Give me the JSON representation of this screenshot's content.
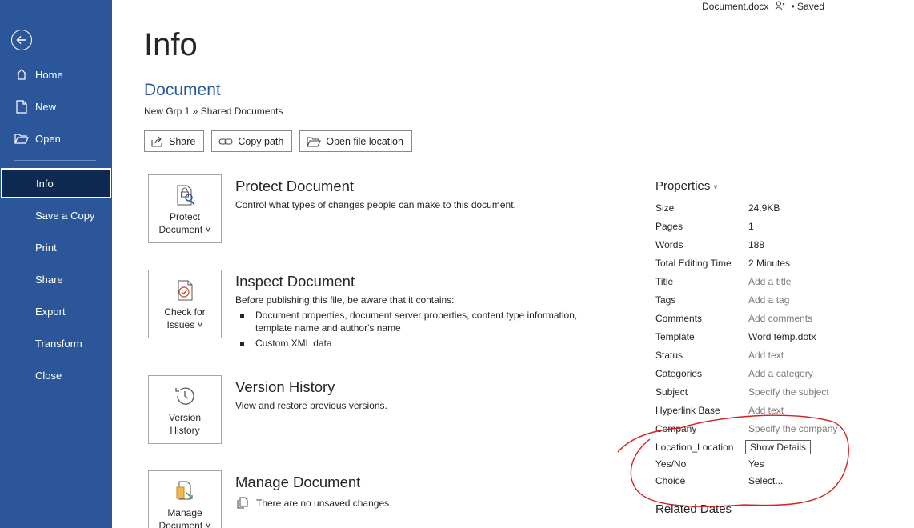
{
  "titlebar": {
    "filename": "Document.docx",
    "saved": "• Saved"
  },
  "sidebar": {
    "back_icon": "back-arrow-icon",
    "items": [
      {
        "label": "Home",
        "icon": "home-icon"
      },
      {
        "label": "New",
        "icon": "new-document-icon"
      },
      {
        "label": "Open",
        "icon": "open-folder-icon"
      },
      {
        "label": "Info"
      },
      {
        "label": "Save a Copy"
      },
      {
        "label": "Print"
      },
      {
        "label": "Share"
      },
      {
        "label": "Export"
      },
      {
        "label": "Transform"
      },
      {
        "label": "Close"
      }
    ],
    "active": "Info",
    "bg_color": "#2b579a"
  },
  "main": {
    "title": "Info",
    "doc_heading": "Document",
    "path": "New Grp 1 » Shared Documents",
    "buttons": [
      {
        "label": "Share",
        "icon": "share-icon"
      },
      {
        "label": "Copy path",
        "icon": "link-icon"
      },
      {
        "label": "Open file location",
        "icon": "folder-icon"
      }
    ],
    "sections": {
      "protect": {
        "card_line1": "Protect",
        "card_line2": "Document ˅",
        "title": "Protect Document",
        "desc": "Control what types of changes people can make to this document."
      },
      "inspect": {
        "card_line1": "Check for",
        "card_line2": "Issues ˅",
        "title": "Inspect Document",
        "desc": "Before publishing this file, be aware that it contains:",
        "bullets": [
          "Document properties, document server properties, content type information, template name and author's name",
          "Custom XML data"
        ]
      },
      "version": {
        "card_line1": "Version",
        "card_line2": "History",
        "title": "Version History",
        "desc": "View and restore previous versions."
      },
      "manage": {
        "card_line1": "Manage",
        "card_line2": "Document ˅",
        "title": "Manage Document",
        "note": "There are no unsaved changes."
      }
    }
  },
  "properties": {
    "heading": "Properties",
    "rows": [
      {
        "key": "Size",
        "value": "24.9KB"
      },
      {
        "key": "Pages",
        "value": "1"
      },
      {
        "key": "Words",
        "value": "188"
      },
      {
        "key": "Total Editing Time",
        "value": "2 Minutes"
      },
      {
        "key": "Title",
        "value": "Add a title"
      },
      {
        "key": "Tags",
        "value": "Add a tag"
      },
      {
        "key": "Comments",
        "value": "Add comments"
      },
      {
        "key": "Template",
        "value": "Word temp.dotx"
      },
      {
        "key": "Status",
        "value": "Add text"
      },
      {
        "key": "Categories",
        "value": "Add a category"
      },
      {
        "key": "Subject",
        "value": "Specify the subject"
      },
      {
        "key": "Hyperlink Base",
        "value": "Add text"
      },
      {
        "key": "Company",
        "value": "Specify the company"
      },
      {
        "key": "Location_Location",
        "value": "Show Details"
      },
      {
        "key": "Yes/No",
        "value": "Yes"
      },
      {
        "key": "Choice",
        "value": "Select..."
      }
    ],
    "related_heading": "Related Dates",
    "annotation_color": "#d62020"
  }
}
